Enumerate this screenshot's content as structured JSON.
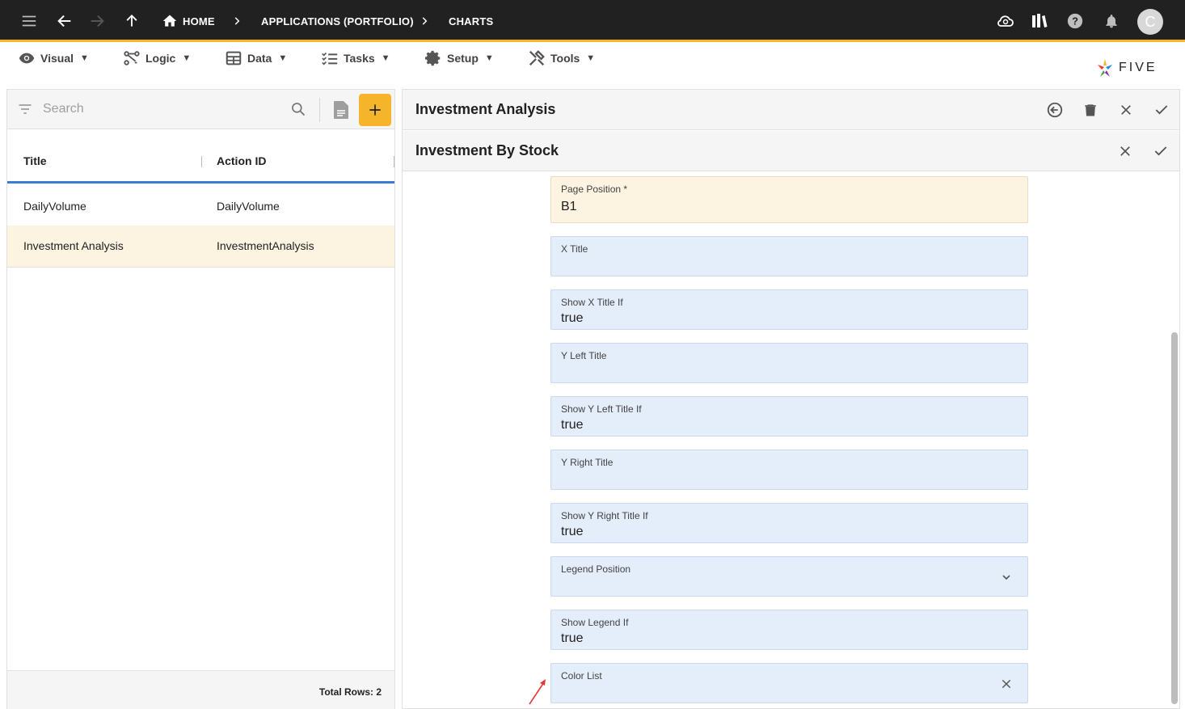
{
  "topbar": {
    "breadcrumbs": [
      {
        "label": "HOME"
      },
      {
        "label": "APPLICATIONS (PORTFOLIO)"
      },
      {
        "label": "CHARTS"
      }
    ],
    "avatar_initial": "C",
    "icons": [
      "menu-icon",
      "back-arrow-icon",
      "forward-arrow-icon",
      "up-arrow-icon",
      "home-icon",
      "cloud-sync-icon",
      "library-icon",
      "help-icon",
      "bell-icon"
    ]
  },
  "menubar": {
    "items": [
      {
        "label": "Visual",
        "icon": "eye-icon"
      },
      {
        "label": "Logic",
        "icon": "logic-icon"
      },
      {
        "label": "Data",
        "icon": "table-icon"
      },
      {
        "label": "Tasks",
        "icon": "tasks-icon"
      },
      {
        "label": "Setup",
        "icon": "gear-icon"
      },
      {
        "label": "Tools",
        "icon": "tools-icon"
      }
    ],
    "caret": "▼",
    "logo_text": "FIVE"
  },
  "list": {
    "search_placeholder": "Search",
    "columns": [
      "Title",
      "Action ID"
    ],
    "rows": [
      {
        "title": "DailyVolume",
        "action_id": "DailyVolume",
        "selected": false
      },
      {
        "title": "Investment Analysis",
        "action_id": "InvestmentAnalysis",
        "selected": true
      }
    ],
    "total_rows": "Total Rows: 2"
  },
  "form": {
    "header_title": "Investment Analysis",
    "sub_title": "Investment By Stock",
    "fields": [
      {
        "label": "Page Position *",
        "value": "B1"
      },
      {
        "label": "X Title",
        "value": ""
      },
      {
        "label": "Show X Title If",
        "value": "true"
      },
      {
        "label": "Y Left Title",
        "value": ""
      },
      {
        "label": "Show Y Left Title If",
        "value": "true"
      },
      {
        "label": "Y Right Title",
        "value": ""
      },
      {
        "label": "Show Y Right Title If",
        "value": "true"
      },
      {
        "label": "Legend Position",
        "value": ""
      },
      {
        "label": "Show Legend If",
        "value": "true"
      },
      {
        "label": "Color List",
        "value": ""
      }
    ]
  },
  "colors": {
    "accent": "#f5b52a",
    "topbar_bg": "#212121",
    "field_bg": "#e4eefb",
    "selected_bg": "#fdf3e1",
    "header_underline": "#3a7bd5"
  }
}
